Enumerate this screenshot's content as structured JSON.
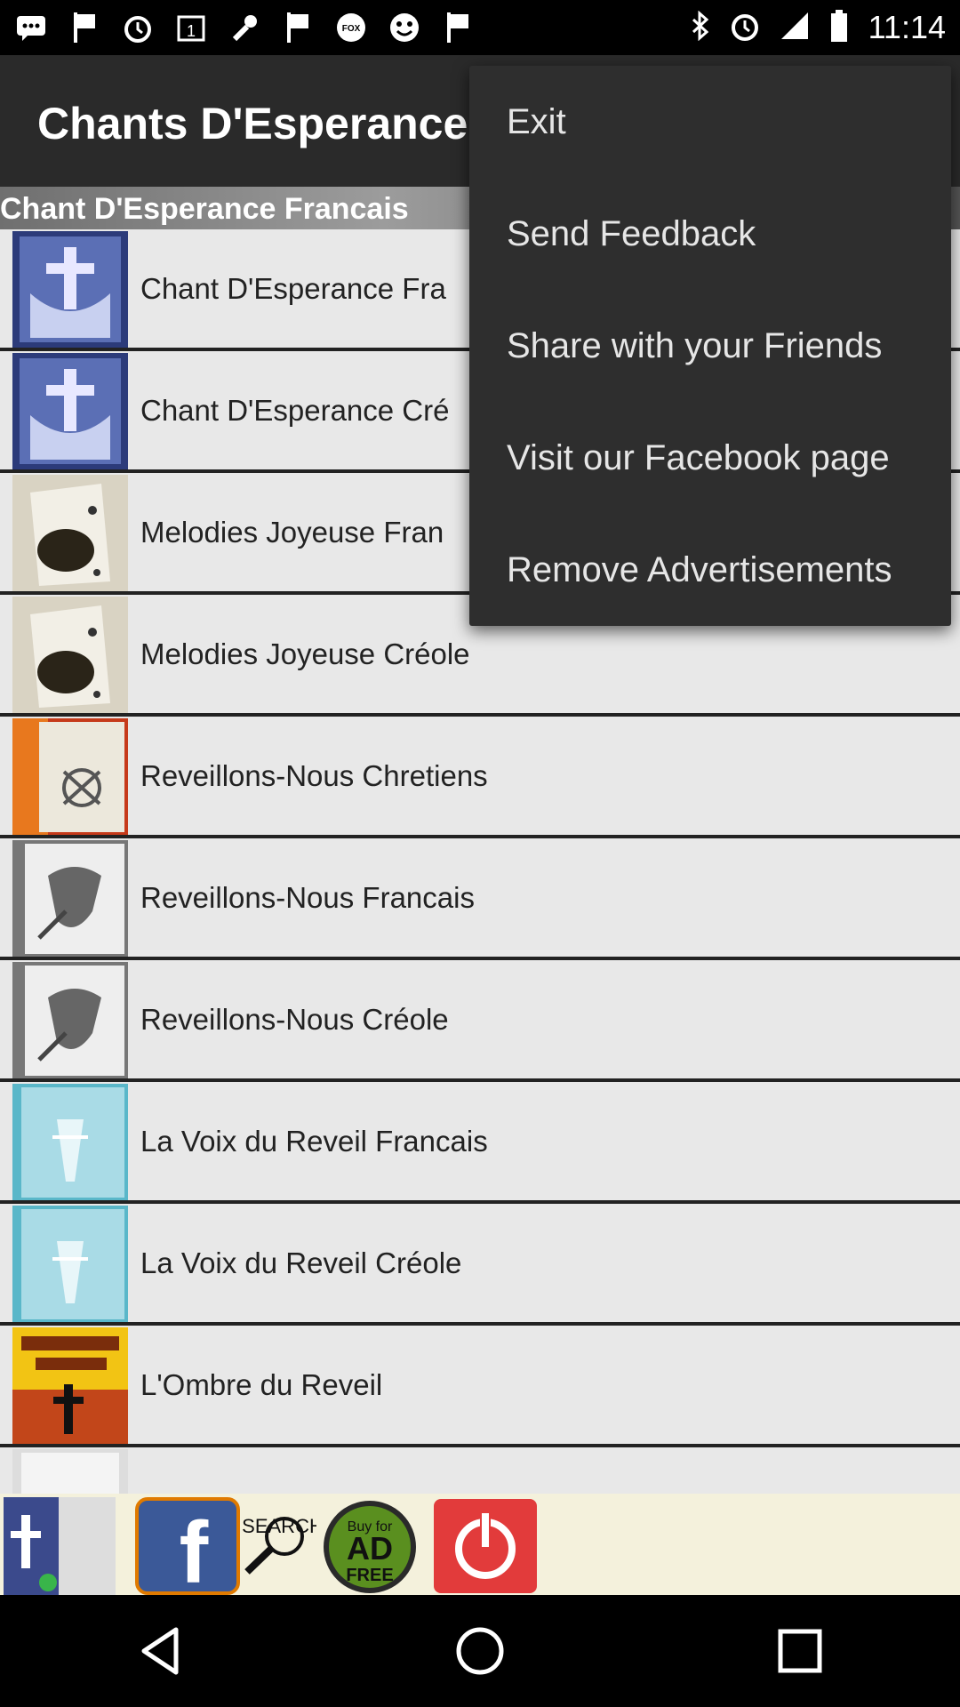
{
  "status_bar": {
    "time": "11:14",
    "left_icons": [
      "messages-icon",
      "flag-icon",
      "alarm-icon",
      "calendar-icon",
      "wrench-icon",
      "flag-icon",
      "fox-sports-icon",
      "smiley-icon",
      "flag-icon"
    ],
    "right_icons": [
      "bluetooth-icon",
      "alarm-icon",
      "signal-icon",
      "battery-icon"
    ]
  },
  "app_bar": {
    "title": "Chants D'Esperance v"
  },
  "section_header": {
    "title": "Chant D'Esperance Francais"
  },
  "list": {
    "items": [
      {
        "label": "Chant D'Esperance Fra",
        "thumb": "cross-book-blue"
      },
      {
        "label": "Chant D'Esperance Cré",
        "thumb": "cross-book-blue"
      },
      {
        "label": "Melodies Joyeuse Fran",
        "thumb": "music-book"
      },
      {
        "label": "Melodies Joyeuse Créole",
        "thumb": "music-book"
      },
      {
        "label": "Reveillons-Nous Chretiens",
        "thumb": "reveillons-chretiens"
      },
      {
        "label": "Reveillons-Nous Francais",
        "thumb": "reveillons-nous"
      },
      {
        "label": "Reveillons-Nous Créole",
        "thumb": "reveillons-nous"
      },
      {
        "label": "La Voix du Reveil Francais",
        "thumb": "voix-reveil"
      },
      {
        "label": "La Voix du Reveil Créole",
        "thumb": "voix-reveil"
      },
      {
        "label": "L'Ombre du Reveil",
        "thumb": "ombre-reveil"
      }
    ]
  },
  "bottom_bar": {
    "search_text": "SEARCH",
    "ad_free_text_1": "Buy for",
    "ad_free_text_2": "AD",
    "ad_free_text_3": "FREE"
  },
  "menu": {
    "items": [
      "Exit",
      "Send Feedback",
      "Share with your Friends",
      "Visit our Facebook page",
      "Remove Advertisements"
    ]
  },
  "colors": {
    "app_bar": "#2a2a2a",
    "menu_bg": "#2e2e2e",
    "list_bg": "#e8e8e8",
    "facebook_blue": "#3b5998",
    "power_red": "#e23b3b",
    "adfree_green": "#5a8f1f"
  }
}
